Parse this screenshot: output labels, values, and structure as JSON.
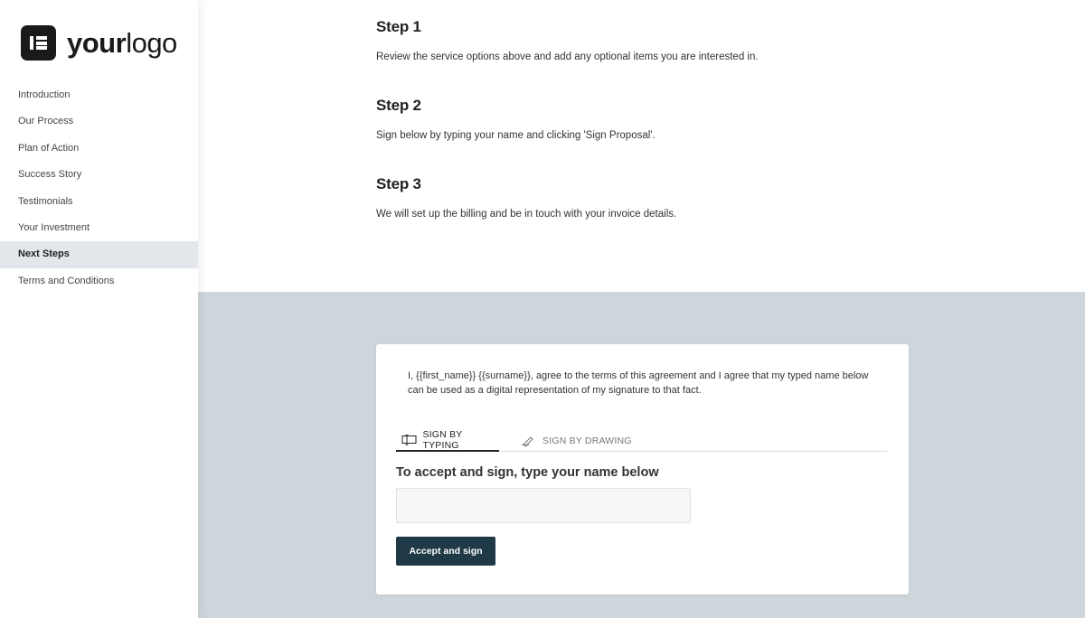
{
  "logo": {
    "text_bold": "your",
    "text_regular": "logo"
  },
  "sidebar": {
    "items": [
      {
        "label": "Introduction"
      },
      {
        "label": "Our Process"
      },
      {
        "label": "Plan of Action"
      },
      {
        "label": "Success Story"
      },
      {
        "label": "Testimonials"
      },
      {
        "label": "Your Investment"
      },
      {
        "label": "Next Steps",
        "active": true
      },
      {
        "label": "Terms and Conditions"
      }
    ]
  },
  "steps": [
    {
      "title": "Step 1",
      "text": "Review the service options above and add any optional items you are interested in."
    },
    {
      "title": "Step 2",
      "text": "Sign below by typing your name and clicking 'Sign Proposal'."
    },
    {
      "title": "Step 3",
      "text": "We will set up the billing and be in touch with your invoice details."
    }
  ],
  "signature": {
    "agreement": "I, {{first_name}} {{surname}}, agree to the terms of this agreement and I agree that my typed name below can be used as a digital representation of my signature to that fact.",
    "tabs": [
      {
        "label": "SIGN BY TYPING",
        "icon": "keyboard-icon",
        "active": true
      },
      {
        "label": "SIGN BY DRAWING",
        "icon": "pen-icon",
        "active": false
      }
    ],
    "heading": "To accept and sign, type your name below",
    "input_value": "",
    "input_placeholder": "",
    "button_label": "Accept and sign"
  },
  "colors": {
    "sidebar_active_bg": "#e3e6ea",
    "bottom_section_bg": "#ced6db",
    "button_bg": "#1f3947"
  }
}
